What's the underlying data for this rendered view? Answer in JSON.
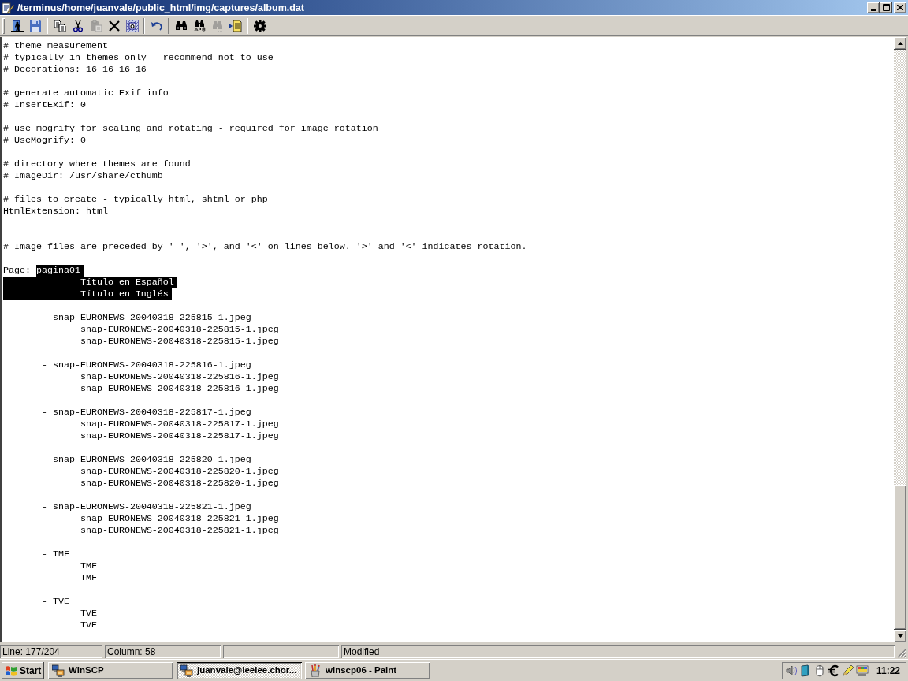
{
  "window": {
    "title": "/terminus/home/juanvale/public_html/img/captures/album.dat"
  },
  "toolbar": {
    "groups": [
      [
        {
          "disabled": false
        },
        {
          "disabled": false
        }
      ],
      [
        {
          "disabled": false
        },
        {
          "disabled": false
        },
        {
          "disabled": true
        },
        {
          "disabled": false
        },
        {
          "disabled": false
        }
      ],
      [
        {
          "disabled": false
        }
      ],
      [
        {
          "disabled": false
        },
        {
          "disabled": false
        },
        {
          "disabled": true
        },
        {
          "disabled": false
        }
      ],
      [
        {
          "disabled": false
        }
      ]
    ]
  },
  "editor": {
    "lines": [
      {
        "kind": "text",
        "text": "# theme measurement",
        "selected": false
      },
      {
        "kind": "text",
        "text": "# typically in themes only - recommend not to use",
        "selected": false
      },
      {
        "kind": "text",
        "text": "# Decorations: 16 16 16 16",
        "selected": false
      },
      {
        "kind": "blank"
      },
      {
        "kind": "text",
        "text": "# generate automatic Exif info",
        "selected": false
      },
      {
        "kind": "text",
        "text": "# InsertExif: 0",
        "selected": false
      },
      {
        "kind": "blank"
      },
      {
        "kind": "text",
        "text": "# use mogrify for scaling and rotating - required for image rotation",
        "selected": false
      },
      {
        "kind": "text",
        "text": "# UseMogrify: 0",
        "selected": false
      },
      {
        "kind": "blank"
      },
      {
        "kind": "text",
        "text": "# directory where themes are found",
        "selected": false
      },
      {
        "kind": "text",
        "text": "# ImageDir: /usr/share/cthumb",
        "selected": false
      },
      {
        "kind": "blank"
      },
      {
        "kind": "text",
        "text": "# files to create - typically html, shtml or php",
        "selected": false
      },
      {
        "kind": "text",
        "text": "HtmlExtension: html",
        "selected": false
      },
      {
        "kind": "blank"
      },
      {
        "kind": "blank"
      },
      {
        "kind": "text",
        "text": "# Image files are preceded by '-', '>', and '<' on lines below. '>' and '<' indicates rotation.",
        "selected": false
      },
      {
        "kind": "blank"
      },
      {
        "kind": "mixed",
        "segments": [
          {
            "text": "Page: ",
            "selected": false
          },
          {
            "text": "pagina01",
            "selected": true
          }
        ]
      },
      {
        "kind": "text",
        "text": "              Título en Español",
        "selected": true
      },
      {
        "kind": "text",
        "text": "              Título en Inglés",
        "selected": true
      },
      {
        "kind": "blank"
      },
      {
        "kind": "text",
        "text": "       - snap-EURONEWS-20040318-225815-1.jpeg",
        "selected": false
      },
      {
        "kind": "text",
        "text": "              snap-EURONEWS-20040318-225815-1.jpeg",
        "selected": false
      },
      {
        "kind": "text",
        "text": "              snap-EURONEWS-20040318-225815-1.jpeg",
        "selected": false
      },
      {
        "kind": "blank"
      },
      {
        "kind": "text",
        "text": "       - snap-EURONEWS-20040318-225816-1.jpeg",
        "selected": false
      },
      {
        "kind": "text",
        "text": "              snap-EURONEWS-20040318-225816-1.jpeg",
        "selected": false
      },
      {
        "kind": "text",
        "text": "              snap-EURONEWS-20040318-225816-1.jpeg",
        "selected": false
      },
      {
        "kind": "blank"
      },
      {
        "kind": "text",
        "text": "       - snap-EURONEWS-20040318-225817-1.jpeg",
        "selected": false
      },
      {
        "kind": "text",
        "text": "              snap-EURONEWS-20040318-225817-1.jpeg",
        "selected": false
      },
      {
        "kind": "text",
        "text": "              snap-EURONEWS-20040318-225817-1.jpeg",
        "selected": false
      },
      {
        "kind": "blank"
      },
      {
        "kind": "text",
        "text": "       - snap-EURONEWS-20040318-225820-1.jpeg",
        "selected": false
      },
      {
        "kind": "text",
        "text": "              snap-EURONEWS-20040318-225820-1.jpeg",
        "selected": false
      },
      {
        "kind": "text",
        "text": "              snap-EURONEWS-20040318-225820-1.jpeg",
        "selected": false
      },
      {
        "kind": "blank"
      },
      {
        "kind": "text",
        "text": "       - snap-EURONEWS-20040318-225821-1.jpeg",
        "selected": false
      },
      {
        "kind": "text",
        "text": "              snap-EURONEWS-20040318-225821-1.jpeg",
        "selected": false
      },
      {
        "kind": "text",
        "text": "              snap-EURONEWS-20040318-225821-1.jpeg",
        "selected": false
      },
      {
        "kind": "blank"
      },
      {
        "kind": "text",
        "text": "       - TMF",
        "selected": false
      },
      {
        "kind": "text",
        "text": "              TMF",
        "selected": false
      },
      {
        "kind": "text",
        "text": "              TMF",
        "selected": false
      },
      {
        "kind": "blank"
      },
      {
        "kind": "text",
        "text": "       - TVE",
        "selected": false
      },
      {
        "kind": "text",
        "text": "              TVE",
        "selected": false
      },
      {
        "kind": "text",
        "text": "              TVE",
        "selected": false
      }
    ]
  },
  "status_bar": {
    "line": "Line: 177/204",
    "column": "Column: 58",
    "state": "Modified"
  },
  "taskbar": {
    "start": "Start",
    "tasks": [
      {
        "label": "WinSCP",
        "selected": false
      },
      {
        "label": "juanvale@leelee.chor...",
        "selected": true
      },
      {
        "label": "winscp06 - Paint",
        "selected": false
      }
    ],
    "clock": "11:22"
  }
}
